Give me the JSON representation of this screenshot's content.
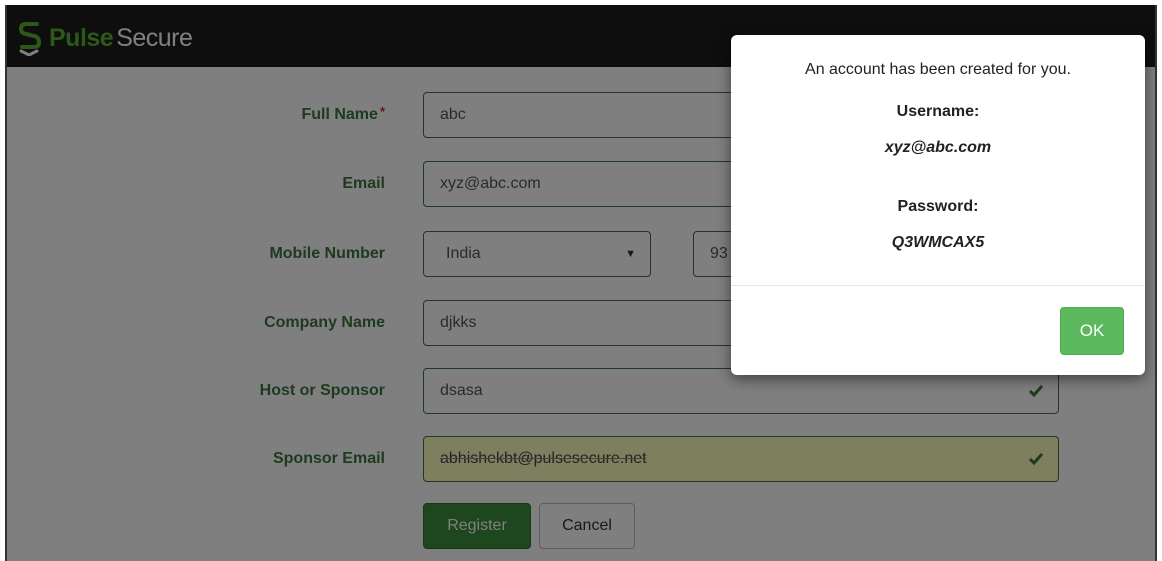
{
  "header": {
    "brand_part1": "Pulse",
    "brand_part2": "Secure"
  },
  "form": {
    "full_name": {
      "label": "Full Name",
      "required_mark": "*",
      "value": "abc"
    },
    "email": {
      "label": "Email",
      "value": "xyz@abc.com"
    },
    "mobile": {
      "label": "Mobile Number",
      "country": "India",
      "number_partial": "93"
    },
    "company": {
      "label": "Company Name",
      "value": "djkks"
    },
    "host": {
      "label": "Host or Sponsor",
      "value": "dsasa"
    },
    "sponsor_email": {
      "label": "Sponsor Email",
      "value": "abhishekbt@pulsesecure.net"
    },
    "register_label": "Register",
    "cancel_label": "Cancel"
  },
  "modal": {
    "message": "An account has been created for you.",
    "username_label": "Username:",
    "username_value": "xyz@abc.com",
    "password_label": "Password:",
    "password_value": "Q3WMCAX5",
    "ok_label": "OK"
  },
  "colors": {
    "brand_green": "#5ab033",
    "label_green": "#3c763d",
    "ok_green": "#5cb85c"
  }
}
